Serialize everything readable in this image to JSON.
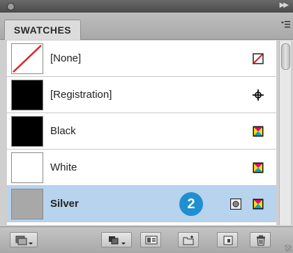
{
  "panel": {
    "tab_label": "SWATCHES",
    "menu_icon": "panel-menu-icon",
    "collapse_icon": "collapse-arrows-icon"
  },
  "swatches": [
    {
      "name": "[None]",
      "color": "none",
      "type_icon": "none-icon",
      "selected": false
    },
    {
      "name": "[Registration]",
      "color": "#000000",
      "type_icon": "registration-target-icon",
      "selected": false
    },
    {
      "name": "Black",
      "color": "#000000",
      "type_icon": "process-color-icon",
      "selected": false
    },
    {
      "name": "White",
      "color": "#ffffff",
      "type_icon": "process-color-icon",
      "selected": false
    },
    {
      "name": "Silver",
      "color": "#a8a8a8",
      "type_icon": "process-color-icon",
      "spot_icon": "spot-color-icon",
      "selected": true
    }
  ],
  "annotation": {
    "badge": "2",
    "badge_color": "#1f8fd1"
  },
  "selection_color": "#b7d3ee",
  "toolbar": [
    {
      "icon": "swatch-libraries-menu-icon"
    },
    {
      "icon": "show-swatch-kinds-icon"
    },
    {
      "icon": "swatch-options-icon"
    },
    {
      "icon": "new-color-group-icon"
    },
    {
      "icon": "new-swatch-icon"
    },
    {
      "icon": "delete-swatch-icon"
    }
  ]
}
